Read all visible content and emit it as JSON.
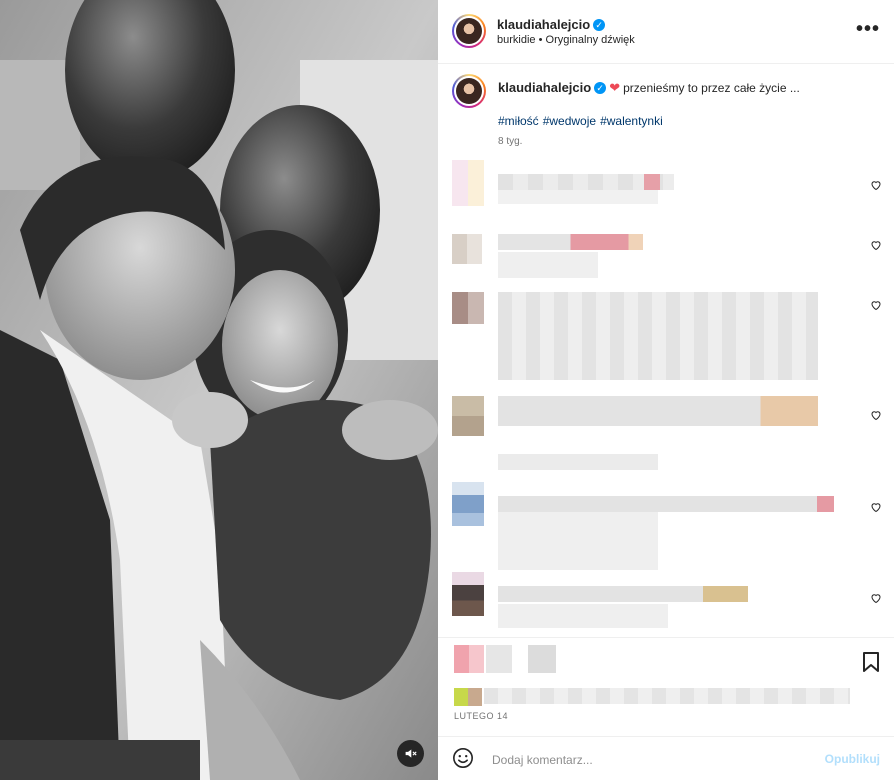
{
  "post": {
    "author": "klaudiahalejcio",
    "audio_artist": "burkidie",
    "audio_separator": "•",
    "audio_track": "Oryginalny dźwięk",
    "more_label": "•••",
    "verified_mark": "✓"
  },
  "caption": {
    "author": "klaudiahalejcio",
    "heart": "❤",
    "text": "przenieśmy to przez całe życie ...",
    "hashtags": [
      "#miłość",
      "#wedwoje",
      "#walentynki"
    ],
    "age": "8 tyg."
  },
  "footer": {
    "date": "LUTEGO 14"
  },
  "comment_box": {
    "placeholder": "Dodaj komentarz...",
    "post_label": "Opublikuj"
  },
  "icons": {
    "mute": "speaker-muted-icon",
    "emoji": "emoji-smile-icon",
    "bookmark": "bookmark-icon",
    "like": "heart-outline-icon",
    "more": "more-options-icon",
    "verified": "verified-badge-icon"
  },
  "colors": {
    "verified_blue": "#0095f6",
    "hashtag": "#00376b",
    "post_button_disabled": "#b2dffc",
    "heart_red": "#ed4956"
  }
}
